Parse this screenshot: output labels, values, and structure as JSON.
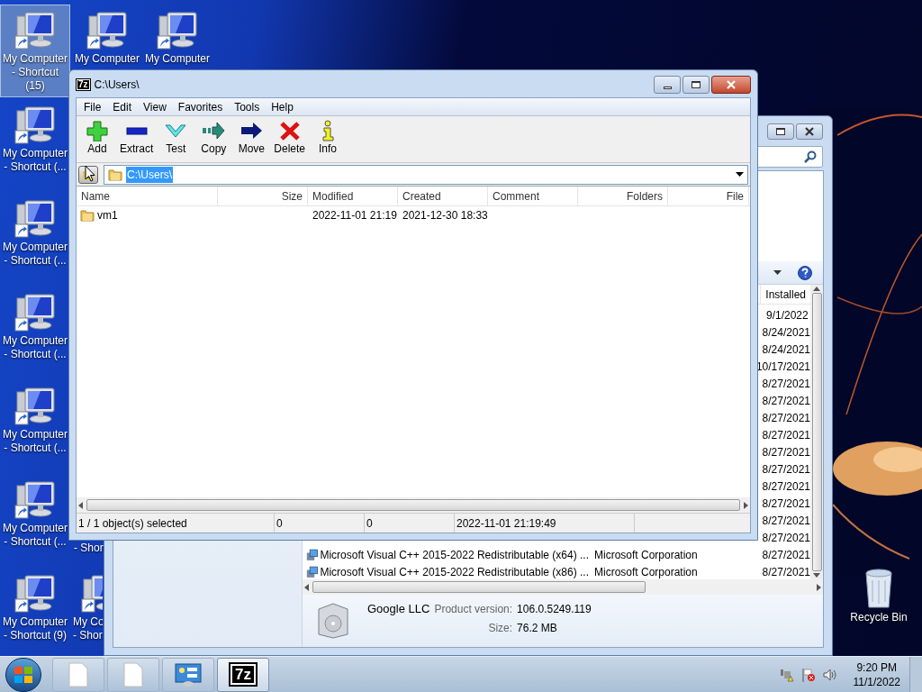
{
  "desktop_icons": [
    {
      "lines": [
        "My Computer",
        "- Shortcut",
        "(15)"
      ],
      "selected": true,
      "kind": "full"
    },
    {
      "lines": [
        "My Computer"
      ],
      "selected": false,
      "kind": "full"
    },
    {
      "lines": [
        "My Computer"
      ],
      "selected": false,
      "kind": "full"
    },
    {
      "lines": [
        "My Computer",
        "- Shortcut (..."
      ],
      "selected": false,
      "kind": "full"
    },
    {
      "lines": [
        "My Computer",
        "- Shortcut (..."
      ],
      "selected": false,
      "kind": "full"
    },
    {
      "lines": [
        "My Computer",
        "- Shortcut (..."
      ],
      "selected": false,
      "kind": "full"
    },
    {
      "lines": [
        "My Computer",
        "- Shortcut (..."
      ],
      "selected": false,
      "kind": "full"
    },
    {
      "lines": [
        "My Computer",
        "- Shortcut (..."
      ],
      "selected": false,
      "kind": "full"
    },
    {
      "lines": [
        "- Shor"
      ],
      "selected": false,
      "kind": "label_only"
    },
    {
      "lines": [
        "My Computer",
        "- Shortcut (9)"
      ],
      "selected": false,
      "kind": "full"
    },
    {
      "lines": [
        "My Co",
        "- Shor"
      ],
      "selected": false,
      "kind": "clipped"
    }
  ],
  "recycle_bin": {
    "label": "Recycle Bin"
  },
  "programs_window": {
    "column_header": "Installed",
    "rows": [
      {
        "installed": "9/1/2022"
      },
      {
        "installed": "8/24/2021"
      },
      {
        "installed": "8/24/2021"
      },
      {
        "installed": "10/17/2021"
      },
      {
        "installed": "8/27/2021"
      },
      {
        "installed": "8/27/2021"
      },
      {
        "installed": "8/27/2021"
      },
      {
        "installed": "8/27/2021"
      },
      {
        "installed": "8/27/2021"
      },
      {
        "installed": "8/27/2021"
      },
      {
        "installed": "8/27/2021"
      },
      {
        "installed": "8/27/2021"
      },
      {
        "installed": "8/27/2021"
      },
      {
        "installed": "8/27/2021"
      },
      {
        "name": "Microsoft Visual C++ 2015-2022 Redistributable (x64) ...",
        "publisher": "Microsoft Corporation",
        "installed": "8/27/2021"
      },
      {
        "name": "Microsoft Visual C++ 2015-2022 Redistributable (x86) ...",
        "publisher": "Microsoft Corporation",
        "installed": "8/27/2021"
      }
    ],
    "details": {
      "publisher": "Google LLC",
      "version_label": "Product version:",
      "version": "106.0.5249.119",
      "size_label": "Size:",
      "size": "76.2 MB"
    }
  },
  "archiver_window": {
    "logo": "7z",
    "title": "C:\\Users\\",
    "menu": [
      "File",
      "Edit",
      "View",
      "Favorites",
      "Tools",
      "Help"
    ],
    "toolbar": [
      {
        "label": "Add",
        "kind": "add"
      },
      {
        "label": "Extract",
        "kind": "extract"
      },
      {
        "label": "Test",
        "kind": "test"
      },
      {
        "label": "Copy",
        "kind": "copy"
      },
      {
        "label": "Move",
        "kind": "move"
      },
      {
        "label": "Delete",
        "kind": "delete"
      },
      {
        "label": "Info",
        "kind": "info"
      }
    ],
    "address": {
      "path": "C:\\Users\\",
      "selected": true
    },
    "columns": [
      "Name",
      "Size",
      "Modified",
      "Created",
      "Comment",
      "Folders",
      "File"
    ],
    "rows": [
      {
        "name": "vm1",
        "modified": "2022-11-01 21:19",
        "created": "2021-12-30 18:33"
      }
    ],
    "status_bar": [
      "1 / 1 object(s) selected",
      "0",
      "0",
      "2022-11-01 21:19:49"
    ]
  },
  "taskbar": {
    "buttons": [
      {
        "kind": "document",
        "active": false
      },
      {
        "kind": "document",
        "active": false
      },
      {
        "kind": "control_panel",
        "active": false
      },
      {
        "kind": "archiver",
        "logo": "7z",
        "active": true
      }
    ],
    "time": "9:20 PM",
    "date": "11/1/2022"
  }
}
